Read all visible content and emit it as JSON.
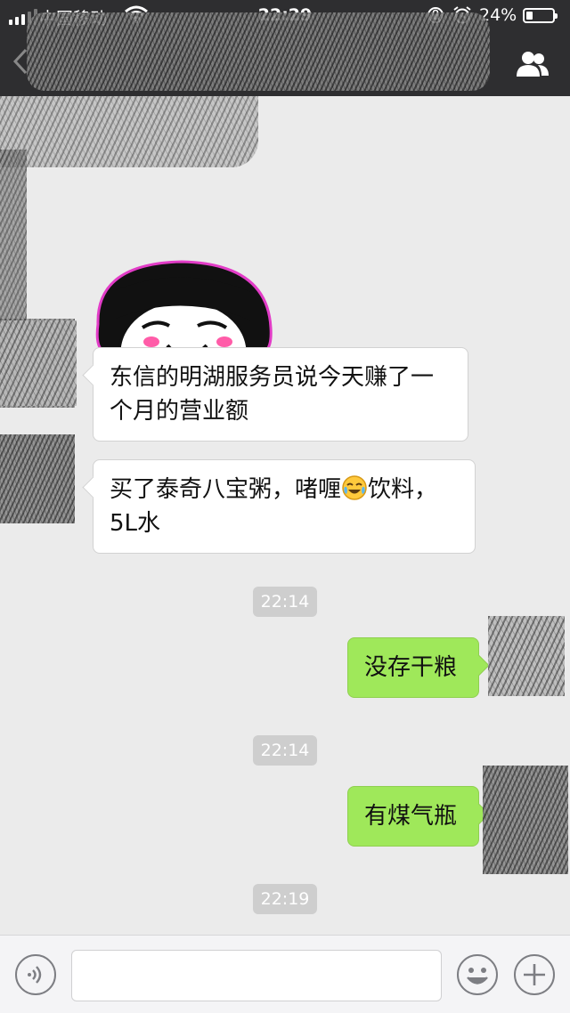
{
  "status_bar": {
    "carrier": "中国移动",
    "time": "22:29",
    "battery_percent_text": "24%",
    "battery_level": 0.24
  },
  "nav": {
    "back_icon": "chevron-left-icon",
    "members_icon": "people-icon"
  },
  "messages": [
    {
      "type": "sticker",
      "side": "in",
      "icon": "bowl-cut-girl-smirk-sticker"
    },
    {
      "type": "text",
      "side": "in",
      "lines": [
        "东信的明湖服务员说今天赚了一",
        "个月的营业额"
      ]
    },
    {
      "type": "text",
      "side": "in",
      "parts": [
        "买了泰奇八宝粥，啫喱",
        "饮料，"
      ],
      "line2": "5L水",
      "emoji": "crying-laughing-face"
    },
    {
      "type": "time",
      "text": "22:14"
    },
    {
      "type": "text",
      "side": "out",
      "text": "没存干粮"
    },
    {
      "type": "time",
      "text": "22:14"
    },
    {
      "type": "text",
      "side": "out",
      "text": "有煤气瓶"
    },
    {
      "type": "time",
      "text": "22:19"
    }
  ],
  "input_bar": {
    "voice_icon": "voice-icon",
    "emoji_icon": "smile-icon",
    "more_icon": "plus-icon",
    "input_value": ""
  },
  "colors": {
    "nav_bg": "#2e2e30",
    "chat_bg": "#ebebeb",
    "outgoing_bubble": "#9fe85a",
    "incoming_bubble": "#ffffff",
    "timestamp_bg": "#cecece"
  }
}
